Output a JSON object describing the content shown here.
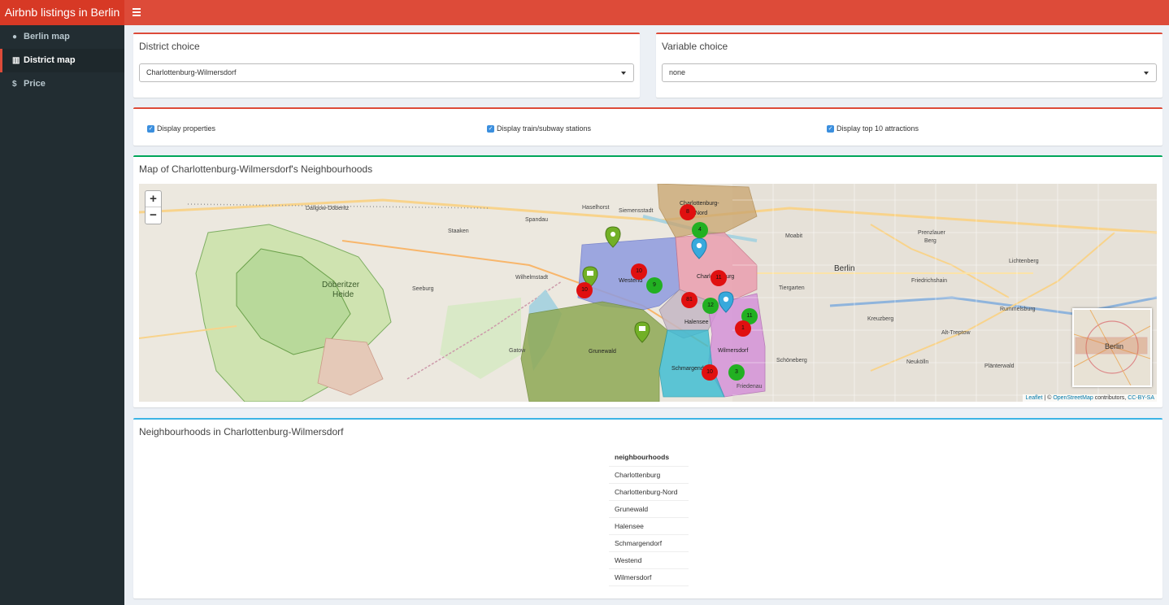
{
  "header": {
    "brand": "Airbnb listings in Berlin"
  },
  "sidebar": {
    "items": [
      {
        "label": "Berlin map",
        "icon": "globe-icon"
      },
      {
        "label": "District map",
        "icon": "map-icon"
      },
      {
        "label": "Price",
        "icon": "dollar-icon"
      }
    ]
  },
  "district_box": {
    "title": "District choice",
    "selected": "Charlottenburg-Wilmersdorf"
  },
  "variable_box": {
    "title": "Variable choice",
    "selected": "none"
  },
  "checks": {
    "properties": "Display properties",
    "stations": "Display train/subway stations",
    "attractions": "Display top 10 attractions"
  },
  "map_box": {
    "title": "Map of Charlottenburg-Wilmersdorf's Neighbourhoods",
    "zoom_in": "+",
    "zoom_out": "−",
    "attribution_leaflet": "Leaflet",
    "attribution_sep": "| ©",
    "attribution_osm": "OpenStreetMap",
    "attribution_rest": "contributors,",
    "attribution_license": "CC-BY-SA",
    "labels": {
      "berlin": "Berlin",
      "doberitzer": "Döberitzer",
      "heide": "Heide",
      "westend": "Westend",
      "charlottenburg": "Charlottenburg",
      "charlottenburg_nord_1": "Charlottenburg-",
      "charlottenburg_nord_2": "Nord",
      "grunewald": "Grunewald",
      "halensee": "Halensee",
      "wilmersdorf": "Wilmersdorf",
      "schmargendorf": "Schmargendorf",
      "friedenau": "Friedenau",
      "moabit": "Moabit",
      "tiergarten": "Tiergarten",
      "schoneberg": "Schöneberg",
      "kreuzberg": "Kreuzberg",
      "neukolln": "Neukölln",
      "friedrichshain": "Friedrichshain",
      "lichtenberg": "Lichtenberg",
      "spandau": "Spandau",
      "staaken": "Staaken",
      "gatow": "Gatow",
      "seeburg": "Seeburg",
      "wilhelmstadt": "Wilhelmstadt",
      "siemensstadt": "Siemensstadt",
      "haselhorst": "Haselhorst",
      "dallgow": "Dallgow-Döberitz",
      "rummelsburg": "Rummelsburg",
      "altreptow": "Alt-Treptow",
      "plaenterwald": "Plänterwald",
      "prenzlauer": "Prenzlauer",
      "berg": "Berg",
      "minimap_berlin": "Berlin"
    },
    "clusters": {
      "c1": "8",
      "c2": "4",
      "c3": "10",
      "c4": "10",
      "c5": "9",
      "c6": "11",
      "c7": "12",
      "c8": "81",
      "c9": "11",
      "c10": "3",
      "c11": "10",
      "c12": "1"
    }
  },
  "table_box": {
    "title": "Neighbourhoods in Charlottenburg-Wilmersdorf",
    "header": "neighbourhoods",
    "rows": [
      "Charlottenburg",
      "Charlottenburg-Nord",
      "Grunewald",
      "Halensee",
      "Schmargendorf",
      "Westend",
      "Wilmersdorf"
    ]
  },
  "colors": {
    "header_red": "#dd4b39",
    "sidebar_dark": "#222d32",
    "green_border": "#00a65a",
    "blue_border": "#3c8dbc",
    "cluster_red": "#e01010",
    "cluster_green": "#22b022"
  }
}
